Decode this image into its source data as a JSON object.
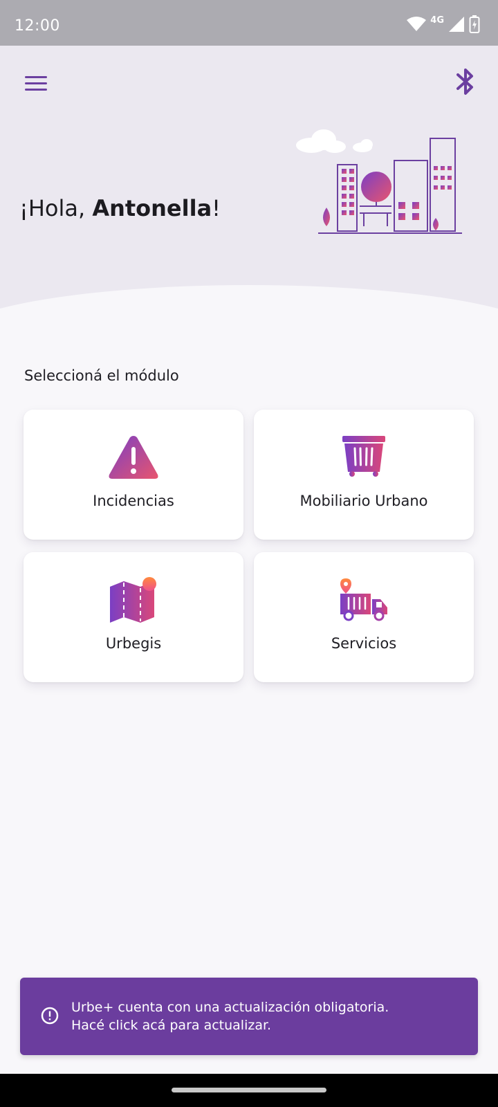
{
  "status_bar": {
    "time": "12:00",
    "network": "4G",
    "icons": [
      "wifi-icon",
      "signal-icon",
      "battery-charging-icon"
    ]
  },
  "header": {
    "menu_icon": "hamburger-menu-icon",
    "bluetooth_icon": "bluetooth-icon",
    "greeting_prefix": "¡Hola, ",
    "user_name": "Antonella",
    "greeting_suffix": "!"
  },
  "main": {
    "section_title": "Seleccioná el módulo",
    "modules": [
      {
        "label": "Incidencias",
        "icon": "warning-icon"
      },
      {
        "label": "Mobiliario Urbano",
        "icon": "trash-container-icon"
      },
      {
        "label": "Urbegis",
        "icon": "map-icon"
      },
      {
        "label": "Servicios",
        "icon": "truck-icon"
      }
    ]
  },
  "banner": {
    "line1": "Urbe+ cuenta con una actualización obligatoria.",
    "line2": "Hacé click acá para actualizar.",
    "icon": "info-icon"
  },
  "colors": {
    "accent": "#6b3d9e",
    "gradient_start": "#7b3fc4",
    "gradient_end": "#e8556e",
    "hero_bg": "#ebe8f0",
    "status_bar": "#acabb1"
  }
}
